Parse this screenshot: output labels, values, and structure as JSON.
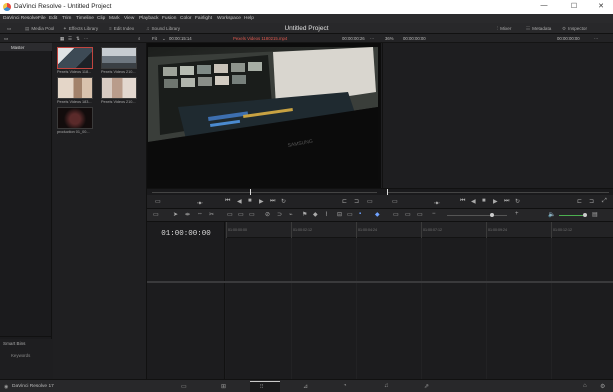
{
  "window": {
    "title": "DaVinci Resolve - Untitled Project",
    "minimize": "—",
    "maximize": "☐",
    "close": "✕"
  },
  "menu": [
    "DaVinci Resolve",
    "File",
    "Edit",
    "Trim",
    "Timeline",
    "Clip",
    "Mark",
    "View",
    "Playback",
    "Fusion",
    "Color",
    "Fairlight",
    "Workspace",
    "Help"
  ],
  "toolbar": {
    "media_pool": "Media Pool",
    "effects_library": "Effects Library",
    "edit_index": "Edit Index",
    "sound_library": "Sound Library",
    "project_title": "Untitled Project",
    "mixer": "Mixer",
    "metadata": "Metadata",
    "inspector": "Inspector"
  },
  "viewer_bar": {
    "zoom_left": "Fit",
    "src_timecode": "00:00:15:14",
    "clip_name": "Pexels Videos 1180215.mp4",
    "src_position": "00:00:00:26",
    "zoom_right": "36%",
    "rec_timecode": "00:00:00:00",
    "rec_position": "00:00:00:00"
  },
  "bins": {
    "master": "Master",
    "smart_bins": "Smart Bins",
    "keywords": "Keywords"
  },
  "clips": [
    {
      "name": "Pexels Videos 118...",
      "color": "#4a5d6e"
    },
    {
      "name": "Pexels Videos 210...",
      "color": "#5e6772"
    },
    {
      "name": "Pexels Videos 183...",
      "color": "#8a7a6c"
    },
    {
      "name": "Pexels Videos 210...",
      "color": "#9e8f87"
    },
    {
      "name": "production 01_00...",
      "color": "#2a1c1c"
    }
  ],
  "timeline": {
    "timecode": "01:00:00:00",
    "ruler": [
      "01:00:00:00",
      "01:00:02:12",
      "01:00:04:24",
      "01:00:07:12",
      "01:00:09:24",
      "01:00:12:12"
    ]
  },
  "footer": {
    "app_name": "DaVinci Resolve 17"
  }
}
